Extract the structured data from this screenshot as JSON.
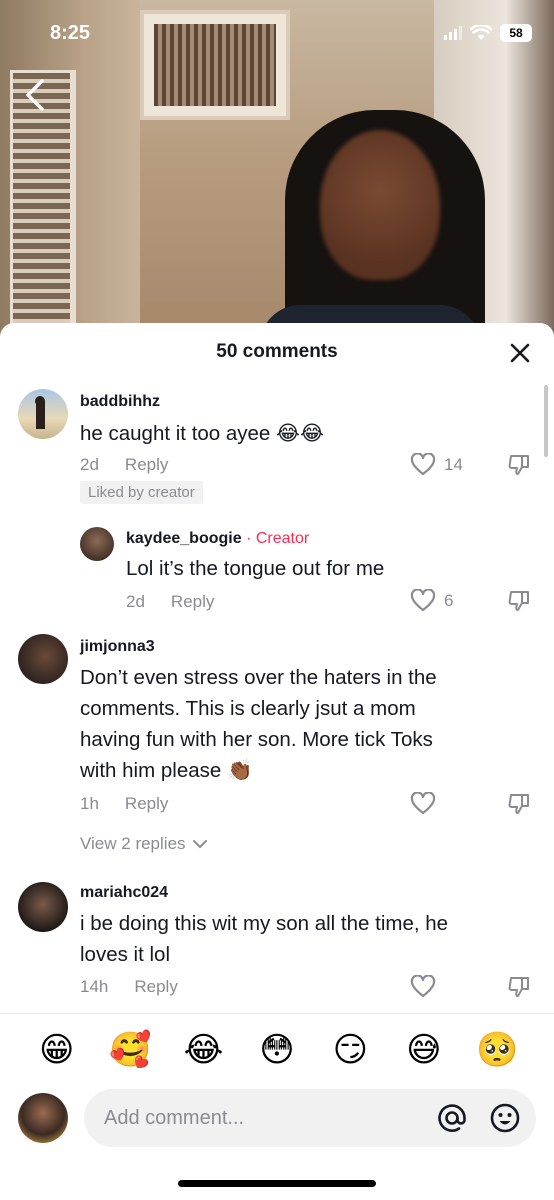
{
  "status_bar": {
    "time": "8:25",
    "battery": "58"
  },
  "sheet": {
    "title": "50 comments"
  },
  "comments": [
    {
      "username": "baddbihhz",
      "text": "he caught it too ayee 😂😂",
      "time": "2d",
      "reply_label": "Reply",
      "likes": "14",
      "liked_by_creator": "Liked by creator"
    },
    {
      "username": "kaydee_boogie",
      "separator": " · ",
      "creator_label": "Creator",
      "text": "Lol it’s the tongue out for me",
      "time": "2d",
      "reply_label": "Reply",
      "likes": "6"
    },
    {
      "username": "jimjonna3",
      "text": "Don’t even stress over the haters in the\ncomments. This is clearly jsut a mom\nhaving fun with her son. More tick Toks\nwith him please 👏🏾",
      "time": "1h",
      "reply_label": "Reply",
      "view_replies": "View 2 replies"
    },
    {
      "username": "mariahc024",
      "text": "i be doing this wit my son all the time, he\nloves it lol",
      "time": "14h",
      "reply_label": "Reply"
    }
  ],
  "emoji_bar": [
    "😁",
    "🥰",
    "😂",
    "😳",
    "😏",
    "😅",
    "🥺"
  ],
  "composer": {
    "placeholder": "Add comment..."
  },
  "colors": {
    "creator": "#fe2c55",
    "secondary_text": "#8a8b91",
    "primary_text": "#161823"
  }
}
